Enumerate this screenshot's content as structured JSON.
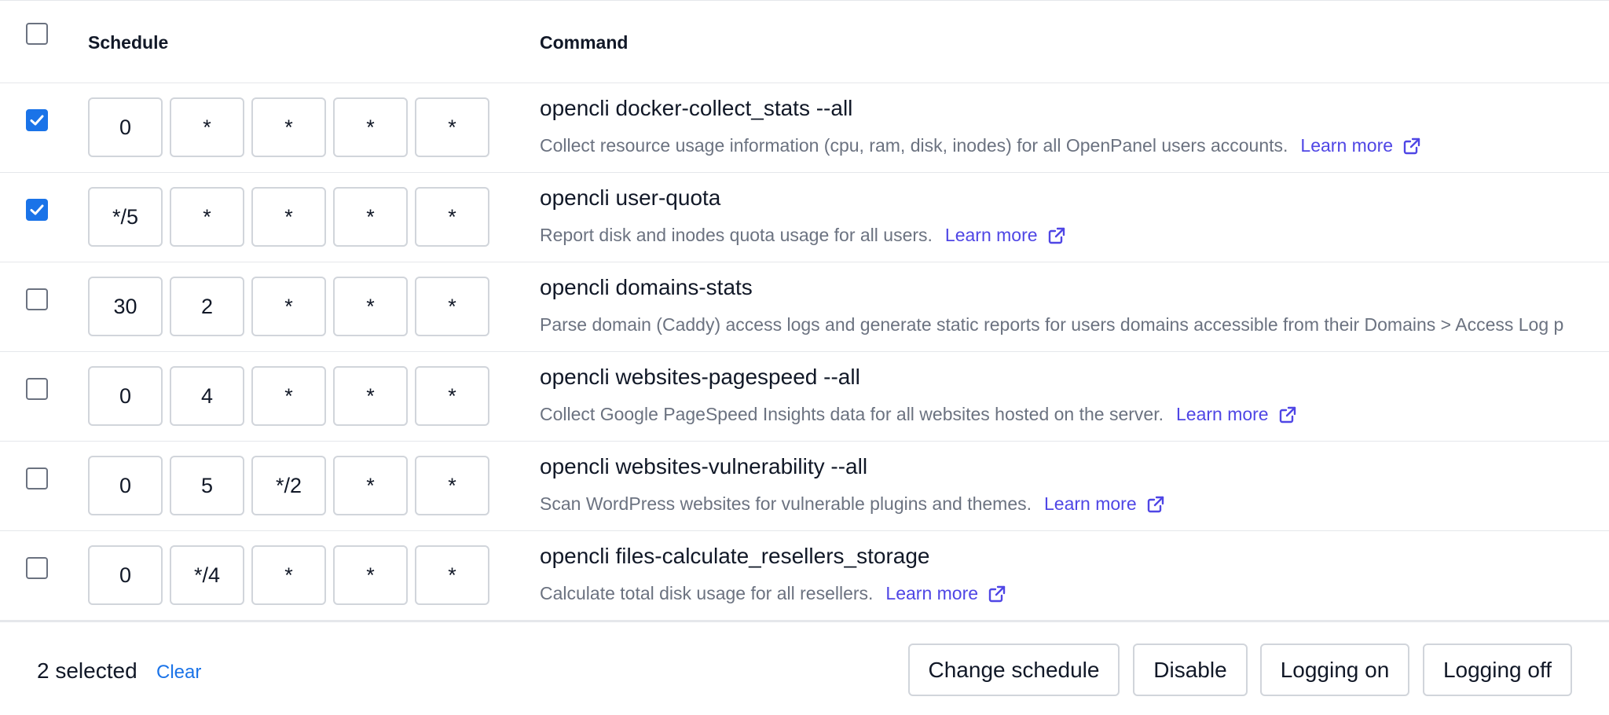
{
  "header": {
    "schedule_label": "Schedule",
    "command_label": "Command",
    "select_all_checked": false
  },
  "learn_more_label": "Learn more",
  "jobs": [
    {
      "checked": true,
      "schedule": [
        "0",
        "*",
        "*",
        "*",
        "*"
      ],
      "command": "opencli docker-collect_stats --all",
      "description": "Collect resource usage information (cpu, ram, disk, inodes) for all OpenPanel users accounts.",
      "has_learn_more": true
    },
    {
      "checked": true,
      "schedule": [
        "*/5",
        "*",
        "*",
        "*",
        "*"
      ],
      "command": "opencli user-quota",
      "description": "Report disk and inodes quota usage for all users.",
      "has_learn_more": true
    },
    {
      "checked": false,
      "schedule": [
        "30",
        "2",
        "*",
        "*",
        "*"
      ],
      "command": "opencli domains-stats",
      "description": "Parse domain (Caddy) access logs and generate static reports for users domains accessible from their Domains > Access Log p",
      "has_learn_more": false
    },
    {
      "checked": false,
      "schedule": [
        "0",
        "4",
        "*",
        "*",
        "*"
      ],
      "command": "opencli websites-pagespeed --all",
      "description": "Collect Google PageSpeed Insights data for all websites hosted on the server.",
      "has_learn_more": true
    },
    {
      "checked": false,
      "schedule": [
        "0",
        "5",
        "*/2",
        "*",
        "*"
      ],
      "command": "opencli websites-vulnerability --all",
      "description": "Scan WordPress websites for vulnerable plugins and themes.",
      "has_learn_more": true
    },
    {
      "checked": false,
      "schedule": [
        "0",
        "*/4",
        "*",
        "*",
        "*"
      ],
      "command": "opencli files-calculate_resellers_storage",
      "description": "Calculate total disk usage for all resellers.",
      "has_learn_more": true
    }
  ],
  "footer": {
    "selected_text": "2 selected",
    "clear_label": "Clear",
    "change_schedule_label": "Change schedule",
    "disable_label": "Disable",
    "logging_on_label": "Logging on",
    "logging_off_label": "Logging off"
  },
  "colors": {
    "checkbox_checked": "#1a73e8",
    "link": "#4f46e5",
    "clear_link": "#1a73e8",
    "description_text": "#6b7280",
    "border": "#e5e7eb"
  },
  "icons": {
    "checkmark": "check-icon",
    "external_link": "external-link-icon"
  }
}
